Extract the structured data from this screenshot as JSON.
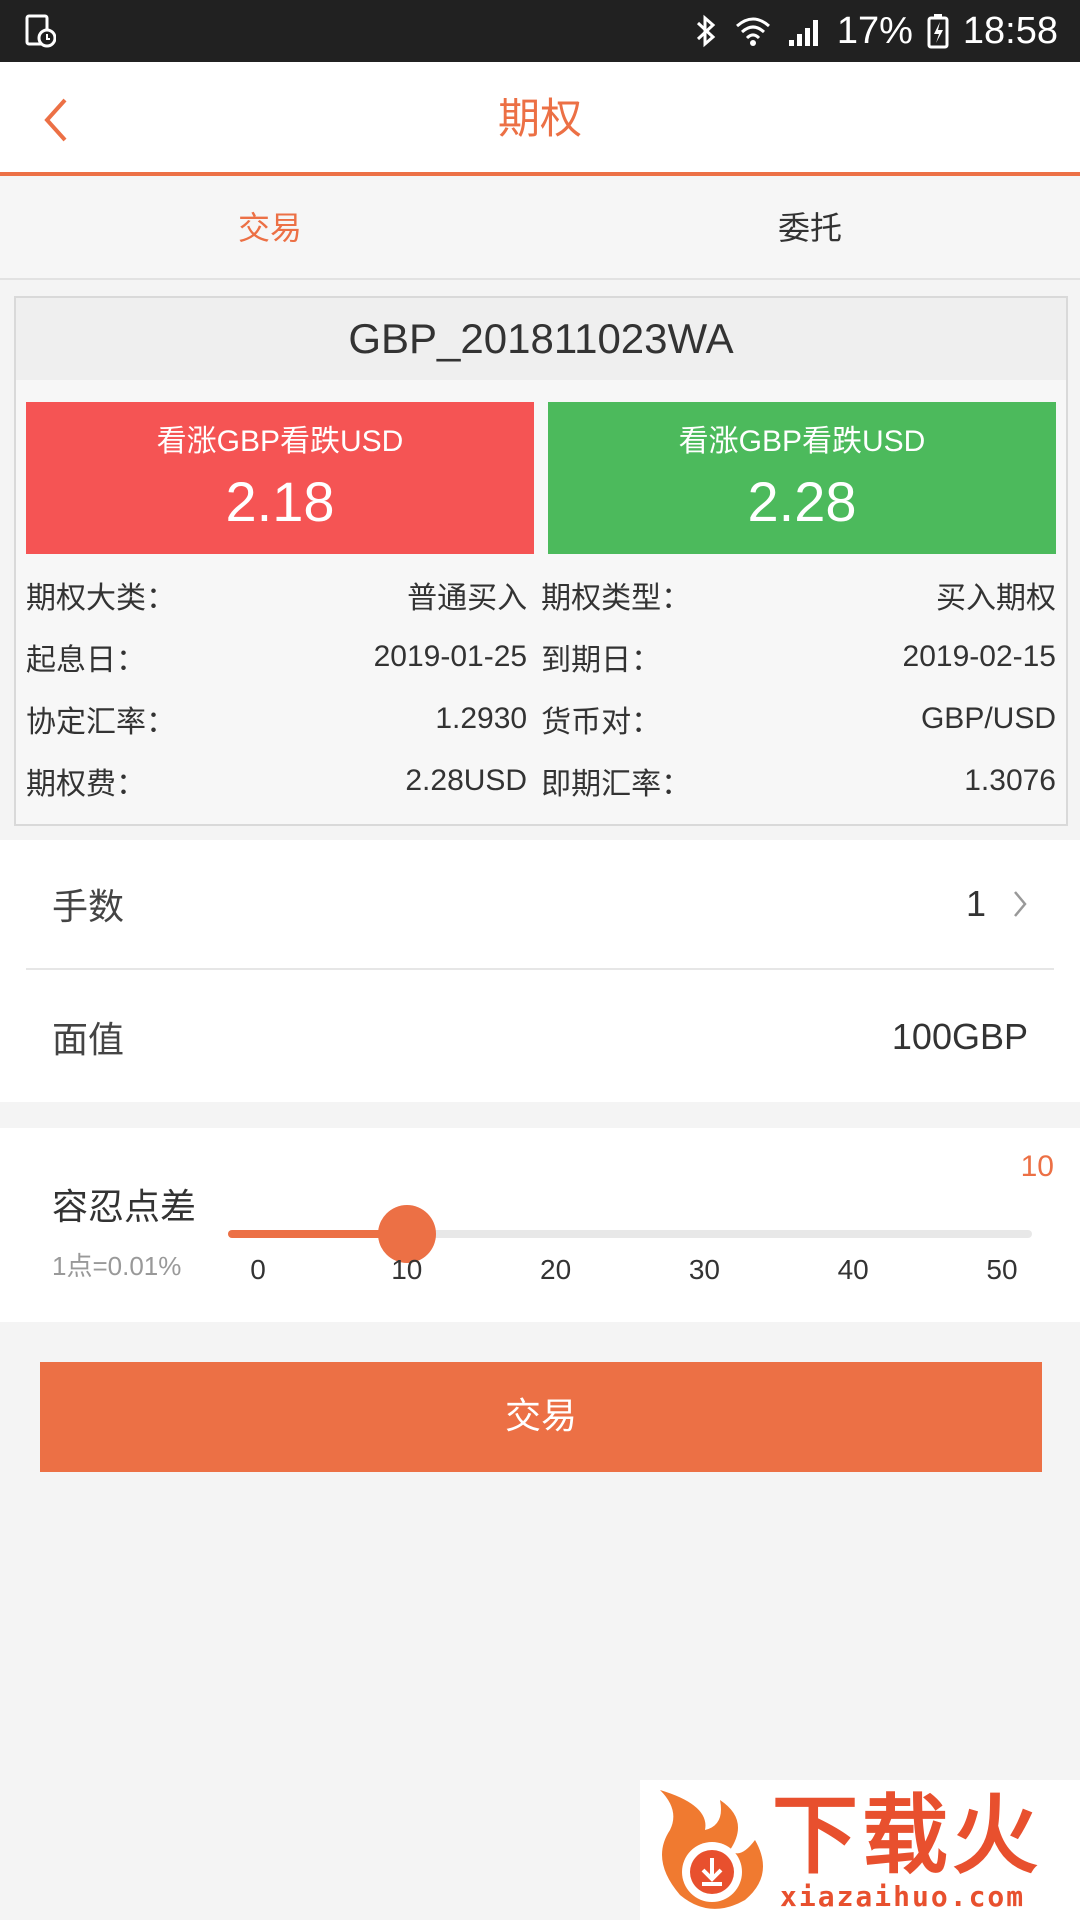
{
  "status_bar": {
    "battery": "17%",
    "time": "18:58"
  },
  "nav": {
    "title": "期权"
  },
  "tabs": [
    {
      "label": "交易",
      "active": true
    },
    {
      "label": "委托",
      "active": false
    }
  ],
  "product": {
    "name": "GBP_201811023WA",
    "call": {
      "label": "看涨GBP看跌USD",
      "price": "2.18"
    },
    "put": {
      "label": "看涨GBP看跌USD",
      "price": "2.28"
    },
    "details": [
      [
        {
          "label": "期权大类：",
          "value": "普通买入"
        },
        {
          "label": "期权类型：",
          "value": "买入期权"
        }
      ],
      [
        {
          "label": "起息日：",
          "value": "2019-01-25"
        },
        {
          "label": "到期日：",
          "value": "2019-02-15"
        }
      ],
      [
        {
          "label": "协定汇率：",
          "value": "1.2930"
        },
        {
          "label": "货币对：",
          "value": "GBP/USD"
        }
      ],
      [
        {
          "label": "期权费：",
          "value": "2.28USD"
        },
        {
          "label": "即期汇率：",
          "value": "1.3076"
        }
      ]
    ]
  },
  "lots": {
    "label": "手数",
    "value": "1"
  },
  "face_value": {
    "label": "面值",
    "value": "100GBP"
  },
  "tolerance": {
    "label": "容忍点差",
    "note": "1点=0.01%",
    "value": 10,
    "value_text": "10",
    "min": 0,
    "max": 50,
    "ticks": [
      "0",
      "10",
      "20",
      "30",
      "40",
      "50"
    ]
  },
  "trade_button": "交易",
  "watermark": {
    "text": "下载火",
    "url": "xiazaihuo.com"
  },
  "colors": {
    "accent": "#ec7045",
    "call": "#f55454",
    "put": "#4cba5c"
  }
}
